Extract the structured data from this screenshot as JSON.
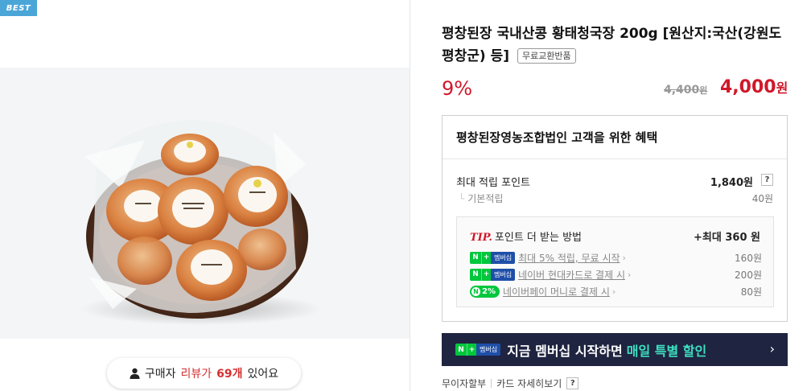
{
  "badge": {
    "label": "BEST"
  },
  "review": {
    "prefix": "구매자",
    "highlight_text": "리뷰가",
    "count": "69개",
    "suffix": "있어요"
  },
  "product": {
    "title": "평창된장 국내산콩 황태청국장 200g [원산지:국산(강원도 평창군) 등]",
    "tag": "무료교환반품",
    "discount": "9%",
    "original_price": "4,400",
    "original_unit": "원",
    "final_price": "4,000",
    "final_unit": "원"
  },
  "benefits": {
    "title": "평창된장영농조합법인 고객을 위한 혜택",
    "max_points_label": "최대 적립 포인트",
    "max_points_value": "1,840원",
    "help": "?",
    "basic_label": "기본적립",
    "basic_value": "40원",
    "tip": {
      "tip_word": "TIP.",
      "title": "포인트 더 받는 방법",
      "max": "+최대 360 원",
      "rows": [
        {
          "badge_n": "N",
          "badge_plus": "+",
          "badge_m": "멤버십",
          "text": "최대 5% 적립, 무료 시작",
          "points": "160원"
        },
        {
          "badge_n": "N",
          "badge_plus": "+",
          "badge_m": "멤버십",
          "text": "네이버 현대카드로 결제 시",
          "points": "200원"
        },
        {
          "pay_circle": "N",
          "pay_pct": "2%",
          "text": "네이버페이 머니로 결제 시",
          "points": "80원"
        }
      ]
    }
  },
  "membership_banner": {
    "badge_n": "N",
    "badge_plus": "+",
    "badge_m": "멤버십",
    "text": "지금 멤버십 시작하면",
    "highlight": "매일 특별 할인",
    "chevron": "›"
  },
  "footer": {
    "link1": "무이자할부",
    "link2": "카드 자세히보기",
    "help": "?"
  },
  "colors": {
    "accent_red": "#d0182a",
    "naver_green": "#00c73c",
    "banner_navy": "#1f2440",
    "banner_highlight": "#3ee0c0",
    "best_badge": "#4ba6d8"
  }
}
